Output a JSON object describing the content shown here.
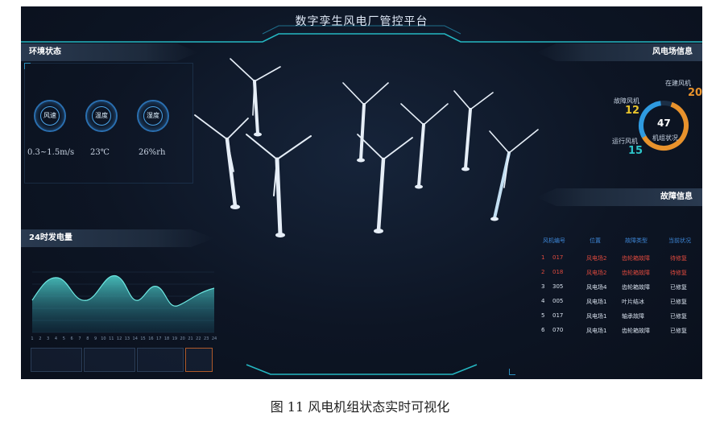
{
  "title": "数字孪生风电厂管控平台",
  "caption": "图 11  风电机组状态实时可视化",
  "env": {
    "header": "环境状态",
    "gauges": [
      {
        "label": "风速",
        "value": "0.3~1.5m/s"
      },
      {
        "label": "温度",
        "value": "23℃"
      },
      {
        "label": "湿度",
        "value": "26%rh"
      }
    ]
  },
  "power": {
    "header": "24时发电量",
    "x_ticks": [
      "1",
      "2",
      "3",
      "4",
      "5",
      "6",
      "7",
      "8",
      "9",
      "10",
      "11",
      "12",
      "13",
      "14",
      "15",
      "16",
      "17",
      "18",
      "19",
      "20",
      "21",
      "22",
      "23",
      "24"
    ]
  },
  "farm": {
    "header": "风电场信息",
    "total": "47",
    "total_label": "机组状况",
    "building_label": "在建风机",
    "building": "20",
    "fault_label": "故障风机",
    "fault": "12",
    "running_label": "运行风机",
    "running": "15"
  },
  "fault": {
    "header": "故障信息",
    "columns": [
      "风机编号",
      "位置",
      "故障类型",
      "当前状况"
    ],
    "rows": [
      {
        "idx": "1",
        "id": "017",
        "loc": "风电场2",
        "type": "齿轮箱故障",
        "status": "待修复",
        "alert": true
      },
      {
        "idx": "2",
        "id": "018",
        "loc": "风电场2",
        "type": "齿轮箱故障",
        "status": "待修复",
        "alert": true
      },
      {
        "idx": "3",
        "id": "305",
        "loc": "风电场4",
        "type": "齿轮箱故障",
        "status": "已修复",
        "alert": false
      },
      {
        "idx": "4",
        "id": "005",
        "loc": "风电场1",
        "type": "叶片结冰",
        "status": "已修复",
        "alert": false
      },
      {
        "idx": "5",
        "id": "017",
        "loc": "风电场1",
        "type": "轴承故障",
        "status": "已修复",
        "alert": false
      },
      {
        "idx": "6",
        "id": "070",
        "loc": "风电场1",
        "type": "齿轮箱故障",
        "status": "已修复",
        "alert": false
      }
    ]
  },
  "colors": {
    "accent_teal": "#2ec4c9",
    "ring_orange": "#e8922c",
    "ring_blue": "#2e9ae0",
    "alert_red": "#e04a3e",
    "header_blue": "#3d86d6"
  }
}
